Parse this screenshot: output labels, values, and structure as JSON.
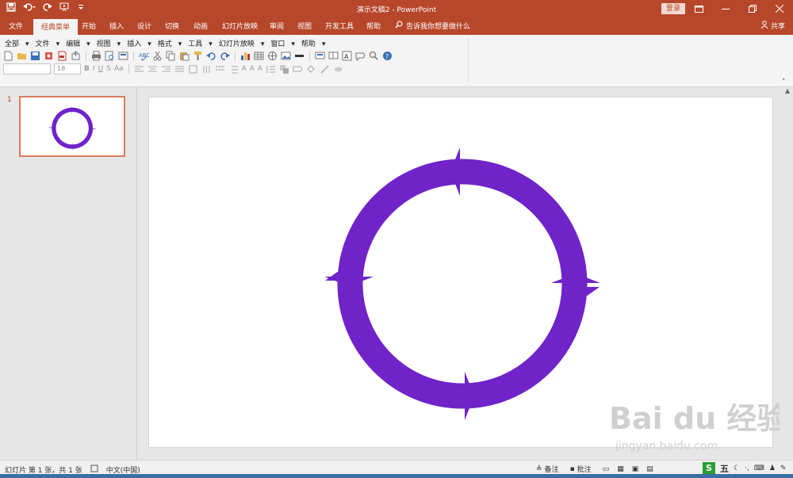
{
  "window": {
    "title": "演示文稿2 - PowerPoint",
    "login_label": "登录",
    "share_label": "共享"
  },
  "ribbon_tabs": [
    "文件",
    "经典菜单",
    "开始",
    "插入",
    "设计",
    "切换",
    "动画",
    "幻灯片放映",
    "审阅",
    "视图",
    "开发工具",
    "帮助"
  ],
  "tell_me": "告诉我你想要做什么",
  "classic_menu": [
    "全部",
    "文件",
    "编辑",
    "视图",
    "插入",
    "格式",
    "工具",
    "幻灯片放映",
    "窗口",
    "帮助"
  ],
  "font": {
    "name": "",
    "size": "18"
  },
  "slides_pane": {
    "slide_number": "1"
  },
  "status": {
    "slide_info": "幻灯片 第 1 张，共 1 张",
    "language": "中文(中国)",
    "notes_label": "备注",
    "comments_label": "批注"
  },
  "ime": {
    "mode": "五"
  },
  "watermark": {
    "brand": "Bai  du 经验",
    "url": "jingyan.baidu.com"
  },
  "colors": {
    "accent": "#b7472a",
    "shape_fill": "#6f23c9"
  },
  "icons": [
    "save-icon",
    "undo-icon",
    "redo-icon",
    "start-from-beginning-icon",
    "customize-qat-icon",
    "restore-ribbon-icon",
    "minimize-icon",
    "restore-icon",
    "close-icon",
    "search-icon",
    "person-icon",
    "help-icon",
    "notes-icon",
    "comments-icon",
    "normal-view-icon",
    "slide-sorter-icon",
    "reading-view-icon",
    "slideshow-icon",
    "fit-slide-icon"
  ]
}
